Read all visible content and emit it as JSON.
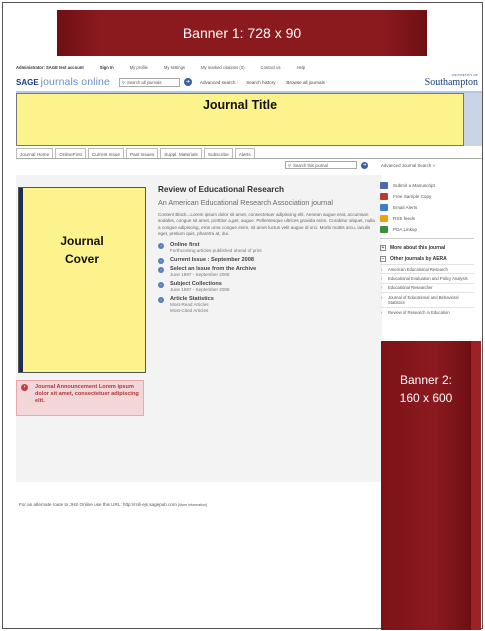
{
  "banner1": "Banner 1:  728 x 90",
  "userbar": {
    "admin": "Administrator: SAGE test account",
    "signin": "Sign In",
    "links": [
      "My profile",
      "My settings",
      "My marked citations (0)",
      "Contact us",
      "Help"
    ]
  },
  "header": {
    "logo_sage": "SAGE",
    "logo_journals": "journals online",
    "search_placeholder": "Search all journals",
    "links": [
      "Advanced search ·",
      "Search history ·",
      "Browse all journals ·"
    ],
    "university_small": "UNIVERSITY OF",
    "university": "Southampton"
  },
  "journal_title": "Journal Title",
  "tabs": [
    "Journal Home",
    "OnlineFirst",
    "Current Issue",
    "Past Issues",
    "Suppl. Materials",
    "Subscribe",
    "Alerts"
  ],
  "journal_search": {
    "placeholder": "Search this journal",
    "advanced": "Advanced Journal Search »"
  },
  "cover": {
    "line1": "Journal",
    "line2": "Cover"
  },
  "announcement": "Journal Announcement Lorem ipsum dolor sit amet, consectetuer adipiscing elit.",
  "info": {
    "title": "Review of Educational Research",
    "subtitle": "An American Educational Research Association journal",
    "blurb": "Content Block...Lorem ipsum dolor sit amet, consectetuer adipiscing elit. Aenean augue erat, accumsan sodales, congue sit amet, porttitor a,get, augue. Pellentesque ultrices gravida enim. Curabitur aliquet, nulla a congue adipiscing, eros urna congue enim, sit amet luctus velit augue id orci. Morbi mattis arcu, iaculis eget, pretium quis, pharetra at, dui.",
    "items": [
      {
        "label": "Online first",
        "sub": [
          "Forthcoming articles published ahead of print"
        ]
      },
      {
        "label": "Current Issue : September 2008",
        "sub": []
      },
      {
        "label": "Select an Issue from the Archive",
        "sub": [
          "June 1997 - September 2008"
        ]
      },
      {
        "label": "Subject Collections",
        "sub": [
          "June 1997 - September 2008"
        ]
      },
      {
        "label": "Article Statistics",
        "sub": [
          "Most-Read Articles",
          "Most-Cited Articles"
        ]
      }
    ]
  },
  "footer_note": "For an alternate route to JHS Online use this URL: http://rnll-ejs.sagepub.com",
  "footer_note_small": "[More information]",
  "sidebar": {
    "tools": [
      {
        "label": "Submit a Manuscript",
        "color": "#4a6aa8"
      },
      {
        "label": "Free Sample Copy",
        "color": "#c0392b"
      },
      {
        "label": "Email Alerts",
        "color": "#3b7fd0"
      },
      {
        "label": "RSS feeds",
        "color": "#f39c12"
      },
      {
        "label": "PDA Linkup",
        "color": "#3c8d3c"
      }
    ],
    "more_title": "More about this journal",
    "other_title": "Other journals by AERA",
    "journals": [
      "American Educational Research",
      "Educational Evaluation and Policy Analysis",
      "Educational Researcher",
      "Journal of Educational and Behavioral Statistics",
      "Review of Research in Education"
    ]
  },
  "banner2": {
    "line1": "Banner 2:",
    "line2": "160 x 600"
  },
  "colors": {
    "banner": "#8b1a1f",
    "title_box": "#fdf38c",
    "announce_bg": "#f3d6d7",
    "accent_blue": "#5a7fb8"
  }
}
